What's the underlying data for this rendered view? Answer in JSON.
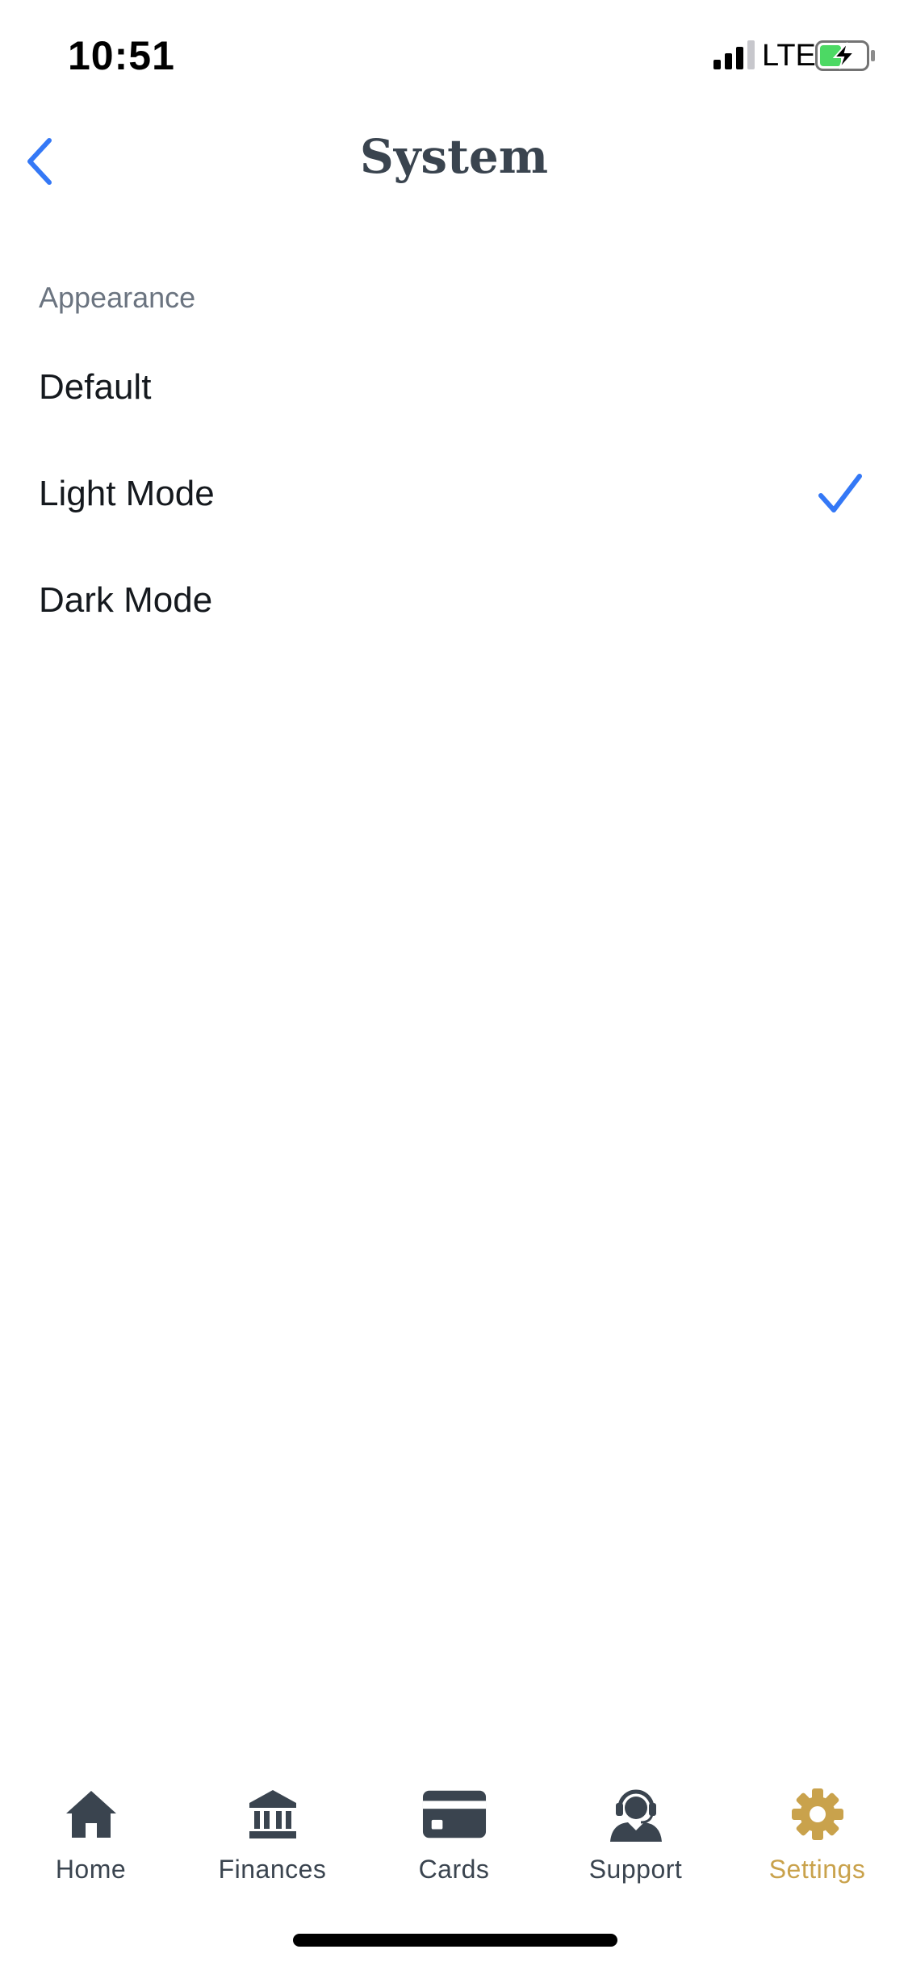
{
  "status_bar": {
    "time": "10:51",
    "network": "LTE",
    "icons": [
      "signal-icon",
      "battery-charging-icon"
    ]
  },
  "header": {
    "title": "System",
    "back_icon": "chevron-left-icon"
  },
  "appearance": {
    "section_title": "Appearance",
    "options": [
      {
        "label": "Default",
        "selected": false
      },
      {
        "label": "Light Mode",
        "selected": true
      },
      {
        "label": "Dark Mode",
        "selected": false
      }
    ],
    "selected_icon": "checkmark-icon"
  },
  "tab_bar": {
    "items": [
      {
        "label": "Home",
        "icon": "home-icon",
        "active": false
      },
      {
        "label": "Finances",
        "icon": "bank-icon",
        "active": false
      },
      {
        "label": "Cards",
        "icon": "credit-card-icon",
        "active": false
      },
      {
        "label": "Support",
        "icon": "support-agent-icon",
        "active": false
      },
      {
        "label": "Settings",
        "icon": "gear-icon",
        "active": true
      }
    ]
  },
  "colors": {
    "accent_blue": "#3478f6",
    "active_tab_gold": "#c9a24c",
    "icon_dark": "#3a444f",
    "battery_green": "#4cd964"
  }
}
